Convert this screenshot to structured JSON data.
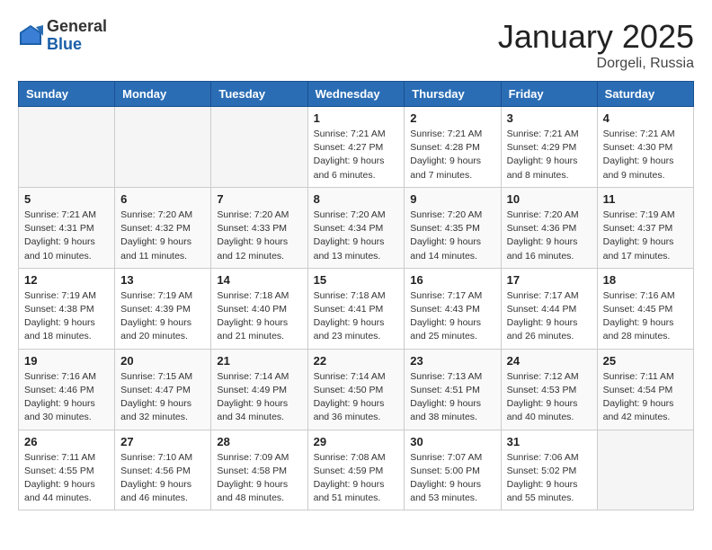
{
  "header": {
    "logo_general": "General",
    "logo_blue": "Blue",
    "month_title": "January 2025",
    "location": "Dorgeli, Russia"
  },
  "weekdays": [
    "Sunday",
    "Monday",
    "Tuesday",
    "Wednesday",
    "Thursday",
    "Friday",
    "Saturday"
  ],
  "weeks": [
    [
      {
        "day": "",
        "info": ""
      },
      {
        "day": "",
        "info": ""
      },
      {
        "day": "",
        "info": ""
      },
      {
        "day": "1",
        "info": "Sunrise: 7:21 AM\nSunset: 4:27 PM\nDaylight: 9 hours and 6 minutes."
      },
      {
        "day": "2",
        "info": "Sunrise: 7:21 AM\nSunset: 4:28 PM\nDaylight: 9 hours and 7 minutes."
      },
      {
        "day": "3",
        "info": "Sunrise: 7:21 AM\nSunset: 4:29 PM\nDaylight: 9 hours and 8 minutes."
      },
      {
        "day": "4",
        "info": "Sunrise: 7:21 AM\nSunset: 4:30 PM\nDaylight: 9 hours and 9 minutes."
      }
    ],
    [
      {
        "day": "5",
        "info": "Sunrise: 7:21 AM\nSunset: 4:31 PM\nDaylight: 9 hours and 10 minutes."
      },
      {
        "day": "6",
        "info": "Sunrise: 7:20 AM\nSunset: 4:32 PM\nDaylight: 9 hours and 11 minutes."
      },
      {
        "day": "7",
        "info": "Sunrise: 7:20 AM\nSunset: 4:33 PM\nDaylight: 9 hours and 12 minutes."
      },
      {
        "day": "8",
        "info": "Sunrise: 7:20 AM\nSunset: 4:34 PM\nDaylight: 9 hours and 13 minutes."
      },
      {
        "day": "9",
        "info": "Sunrise: 7:20 AM\nSunset: 4:35 PM\nDaylight: 9 hours and 14 minutes."
      },
      {
        "day": "10",
        "info": "Sunrise: 7:20 AM\nSunset: 4:36 PM\nDaylight: 9 hours and 16 minutes."
      },
      {
        "day": "11",
        "info": "Sunrise: 7:19 AM\nSunset: 4:37 PM\nDaylight: 9 hours and 17 minutes."
      }
    ],
    [
      {
        "day": "12",
        "info": "Sunrise: 7:19 AM\nSunset: 4:38 PM\nDaylight: 9 hours and 18 minutes."
      },
      {
        "day": "13",
        "info": "Sunrise: 7:19 AM\nSunset: 4:39 PM\nDaylight: 9 hours and 20 minutes."
      },
      {
        "day": "14",
        "info": "Sunrise: 7:18 AM\nSunset: 4:40 PM\nDaylight: 9 hours and 21 minutes."
      },
      {
        "day": "15",
        "info": "Sunrise: 7:18 AM\nSunset: 4:41 PM\nDaylight: 9 hours and 23 minutes."
      },
      {
        "day": "16",
        "info": "Sunrise: 7:17 AM\nSunset: 4:43 PM\nDaylight: 9 hours and 25 minutes."
      },
      {
        "day": "17",
        "info": "Sunrise: 7:17 AM\nSunset: 4:44 PM\nDaylight: 9 hours and 26 minutes."
      },
      {
        "day": "18",
        "info": "Sunrise: 7:16 AM\nSunset: 4:45 PM\nDaylight: 9 hours and 28 minutes."
      }
    ],
    [
      {
        "day": "19",
        "info": "Sunrise: 7:16 AM\nSunset: 4:46 PM\nDaylight: 9 hours and 30 minutes."
      },
      {
        "day": "20",
        "info": "Sunrise: 7:15 AM\nSunset: 4:47 PM\nDaylight: 9 hours and 32 minutes."
      },
      {
        "day": "21",
        "info": "Sunrise: 7:14 AM\nSunset: 4:49 PM\nDaylight: 9 hours and 34 minutes."
      },
      {
        "day": "22",
        "info": "Sunrise: 7:14 AM\nSunset: 4:50 PM\nDaylight: 9 hours and 36 minutes."
      },
      {
        "day": "23",
        "info": "Sunrise: 7:13 AM\nSunset: 4:51 PM\nDaylight: 9 hours and 38 minutes."
      },
      {
        "day": "24",
        "info": "Sunrise: 7:12 AM\nSunset: 4:53 PM\nDaylight: 9 hours and 40 minutes."
      },
      {
        "day": "25",
        "info": "Sunrise: 7:11 AM\nSunset: 4:54 PM\nDaylight: 9 hours and 42 minutes."
      }
    ],
    [
      {
        "day": "26",
        "info": "Sunrise: 7:11 AM\nSunset: 4:55 PM\nDaylight: 9 hours and 44 minutes."
      },
      {
        "day": "27",
        "info": "Sunrise: 7:10 AM\nSunset: 4:56 PM\nDaylight: 9 hours and 46 minutes."
      },
      {
        "day": "28",
        "info": "Sunrise: 7:09 AM\nSunset: 4:58 PM\nDaylight: 9 hours and 48 minutes."
      },
      {
        "day": "29",
        "info": "Sunrise: 7:08 AM\nSunset: 4:59 PM\nDaylight: 9 hours and 51 minutes."
      },
      {
        "day": "30",
        "info": "Sunrise: 7:07 AM\nSunset: 5:00 PM\nDaylight: 9 hours and 53 minutes."
      },
      {
        "day": "31",
        "info": "Sunrise: 7:06 AM\nSunset: 5:02 PM\nDaylight: 9 hours and 55 minutes."
      },
      {
        "day": "",
        "info": ""
      }
    ]
  ]
}
